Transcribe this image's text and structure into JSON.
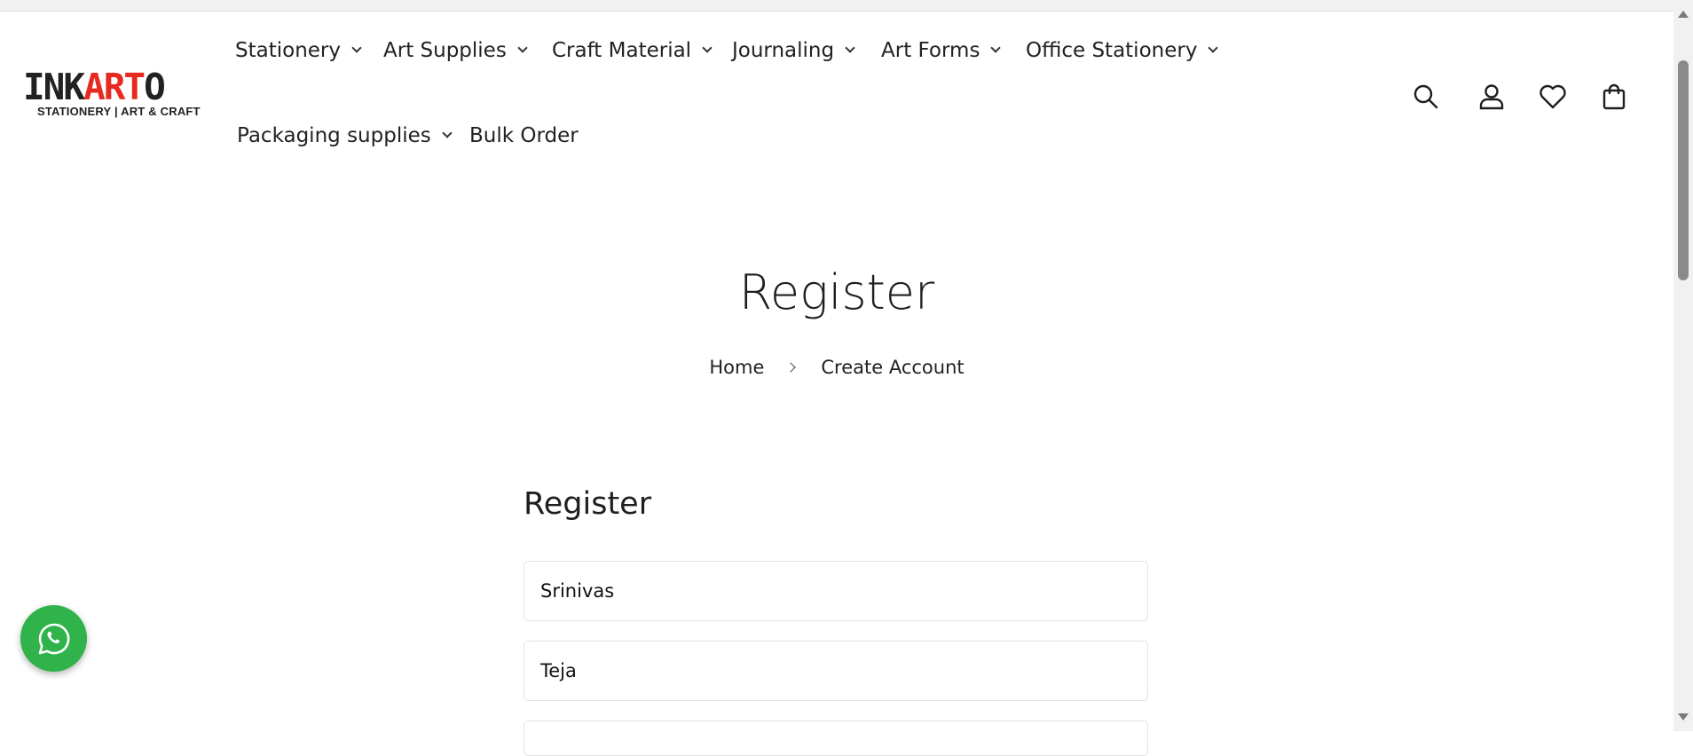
{
  "brand": {
    "word_dark": "INK",
    "word_red": "ART",
    "word_end": "O",
    "tagline": "STATIONERY | ART & CRAFT",
    "accent_color": "#e62a20"
  },
  "nav": {
    "items": [
      {
        "label": "Stationery",
        "has_dropdown": true
      },
      {
        "label": "Art Supplies",
        "has_dropdown": true
      },
      {
        "label": "Craft Material",
        "has_dropdown": true
      },
      {
        "label": "Journaling",
        "has_dropdown": true
      },
      {
        "label": "Art Forms",
        "has_dropdown": true
      },
      {
        "label": "Office Stationery",
        "has_dropdown": true
      },
      {
        "label": "Packaging supplies",
        "has_dropdown": true
      },
      {
        "label": "Bulk Order",
        "has_dropdown": false
      }
    ]
  },
  "header_icons": [
    "search-icon",
    "account-icon",
    "wishlist-heart-icon",
    "cart-bag-icon"
  ],
  "page": {
    "title": "Register",
    "breadcrumb": {
      "home": "Home",
      "current": "Create Account"
    }
  },
  "form": {
    "heading": "Register",
    "first_name_value": "Srinivas",
    "last_name_value": "Teja"
  },
  "floating": {
    "whatsapp_icon": "whatsapp-icon",
    "whatsapp_color": "#2fb34a"
  }
}
